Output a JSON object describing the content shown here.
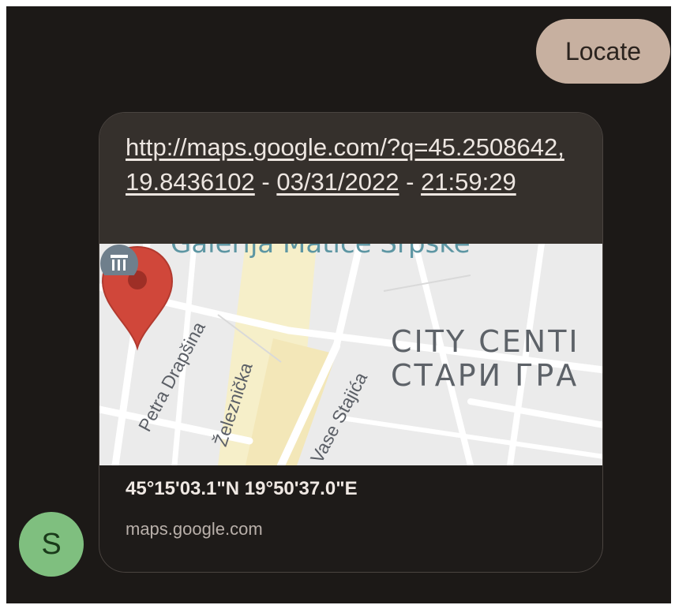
{
  "sent_message": {
    "text": "Locate"
  },
  "received_message": {
    "link_text": "http://maps.google.com/?q=45.2508642,19.8436102",
    "separator": " - ",
    "date": "03/31/2022",
    "time": "21:59:29",
    "preview": {
      "map": {
        "top_label": "Galerija Matice Srpske",
        "streets": [
          "Petra Drapšina",
          "Železnička",
          "Vase Stajića"
        ],
        "district_lines": [
          "CITY CENTI",
          "СТАРИ ГРА"
        ],
        "pin_icon": "map-pin-icon",
        "poi_icon": "museum-icon"
      },
      "title": "45°15'03.1\"N 19°50'37.0\"E",
      "domain": "maps.google.com"
    }
  },
  "sender": {
    "initial": "S"
  },
  "colors": {
    "background": "#1c1917",
    "sent_bubble": "#c7b0a0",
    "avatar": "#7fbf7f",
    "pin": "#d0473a"
  }
}
